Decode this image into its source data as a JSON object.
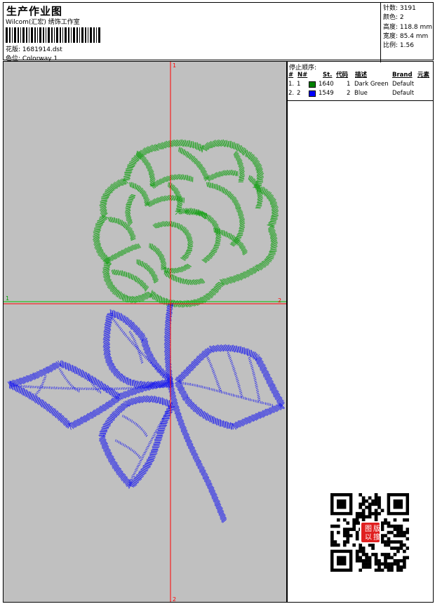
{
  "header": {
    "title": "生产作业图",
    "company": "Wilcom(汇宏) 绣饰工作室",
    "design_label": "花版: 1681914.dst",
    "colorway_label": "色位: Colorway 1"
  },
  "stats": {
    "stitches": "针数: 3191",
    "colors": "颜色: 2",
    "height": "高度: 118.8 mm",
    "width": "宽度: 85.4 mm",
    "scale": "比例: 1.56"
  },
  "sequence": {
    "title": "停止顺序:",
    "headers": {
      "idx": "#",
      "no": "N#",
      "st": "St.",
      "code": "代码",
      "desc": "描述",
      "brand": "Brand",
      "element": "元素"
    },
    "rows": [
      {
        "idx": "1.",
        "no": "1",
        "color": "#008000",
        "st": "1640",
        "code": "1",
        "desc": "Dark Green",
        "brand": "Default"
      },
      {
        "idx": "2.",
        "no": "2",
        "color": "#0000ff",
        "st": "1549",
        "code": "2",
        "desc": "Blue",
        "brand": "Default"
      }
    ]
  },
  "canvas": {
    "marker_top": "1",
    "marker_bottom": "2",
    "marker_left": "1",
    "marker_right": "2",
    "colors": {
      "flower": "#18a018",
      "stem": "#1c1cee",
      "crosshair_red": "#ff0000",
      "crosshair_green": "#00c000",
      "background": "#c0c0c0"
    }
  },
  "qr": {
    "stamp_text": "以图搜版"
  }
}
